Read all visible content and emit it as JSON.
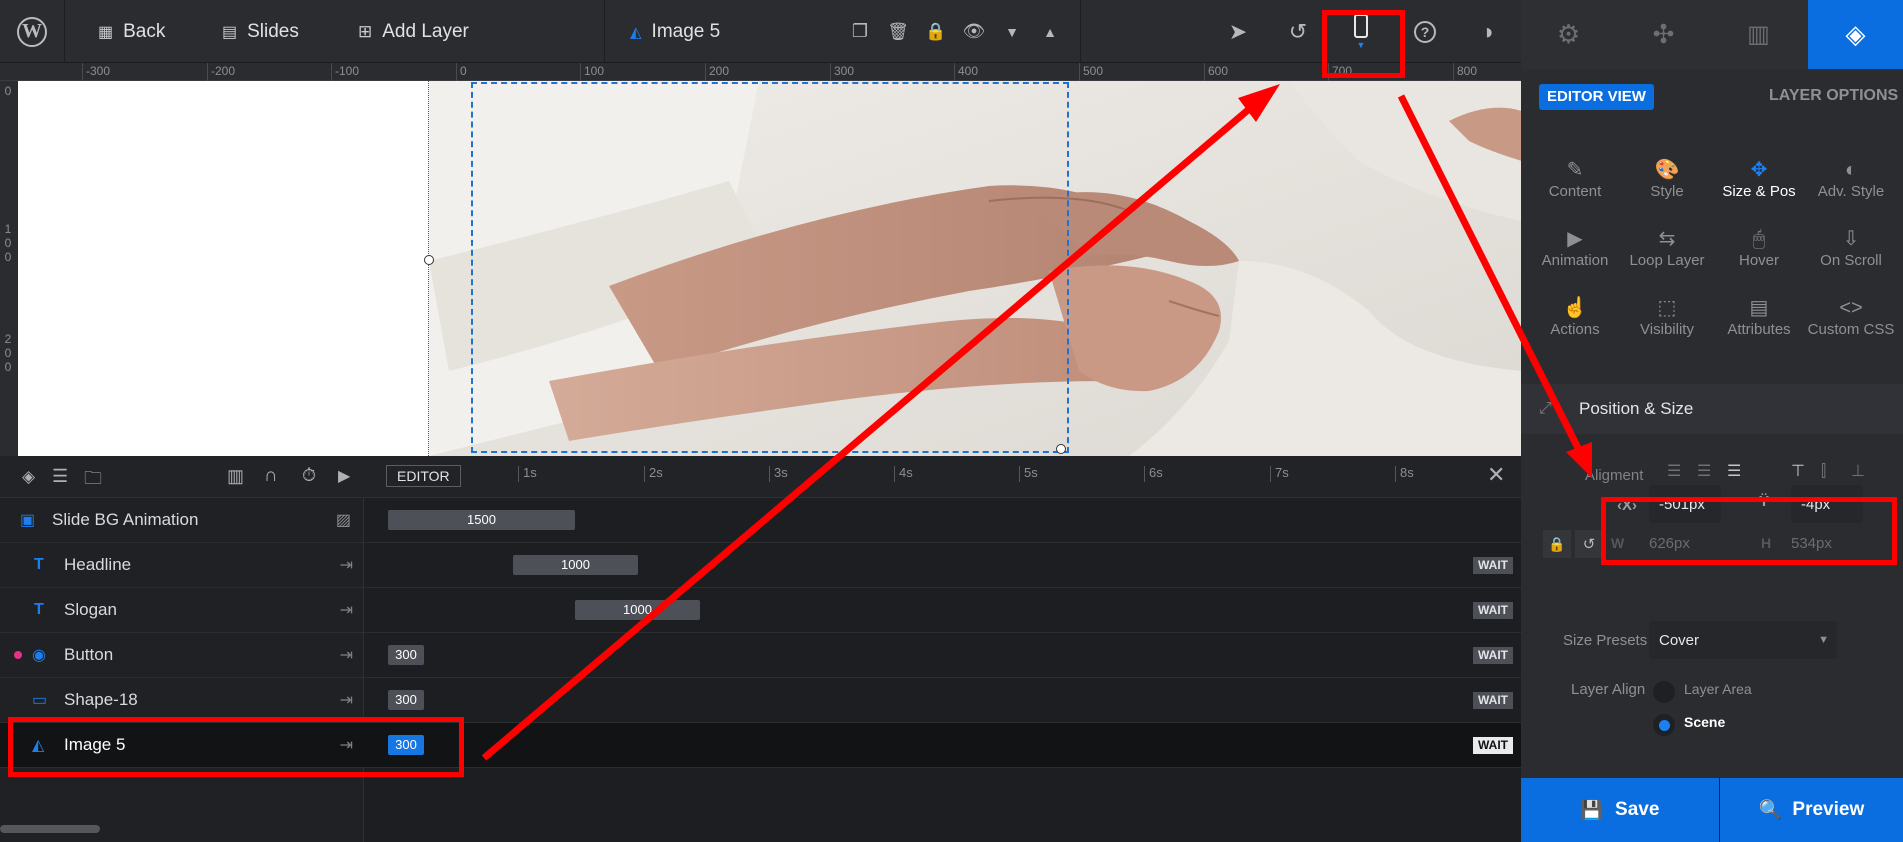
{
  "topbar": {
    "back": "Back",
    "slides": "Slides",
    "add_layer": "Add Layer",
    "layer_name": "Image 5"
  },
  "ruler": {
    "h": [
      "-300",
      "-200",
      "-100",
      "0",
      "100",
      "200",
      "300",
      "400",
      "500",
      "600",
      "700",
      "800"
    ],
    "v": [
      [
        "0"
      ],
      [
        "1",
        "0",
        "0"
      ],
      [
        "2",
        "0",
        "0"
      ]
    ]
  },
  "panel": {
    "editor_view": "EDITOR VIEW",
    "layer_options": "LAYER OPTIONS",
    "options": [
      {
        "label": "Content",
        "icon": "pencil-icon",
        "glyph": "✎"
      },
      {
        "label": "Style",
        "icon": "palette-icon",
        "glyph": "🎨"
      },
      {
        "label": "Size & Pos",
        "icon": "move-icon",
        "glyph": "✥"
      },
      {
        "label": "Adv. Style",
        "icon": "contrast-icon",
        "glyph": "◐"
      },
      {
        "label": "Animation",
        "icon": "play-icon",
        "glyph": "▶"
      },
      {
        "label": "Loop Layer",
        "icon": "loop-icon",
        "glyph": "⇆"
      },
      {
        "label": "Hover",
        "icon": "mouse-icon",
        "glyph": "🖱"
      },
      {
        "label": "On Scroll",
        "icon": "scroll-icon",
        "glyph": "⇩"
      },
      {
        "label": "Actions",
        "icon": "hand-icon",
        "glyph": "☝"
      },
      {
        "label": "Visibility",
        "icon": "visibility-icon",
        "glyph": "⬚"
      },
      {
        "label": "Attributes",
        "icon": "file-icon",
        "glyph": "▤"
      },
      {
        "label": "Custom CSS",
        "icon": "code-icon",
        "glyph": "<>"
      }
    ],
    "section_title": "Position & Size",
    "alignment_label": "Aligment",
    "x_value": "-501px",
    "y_value": "-4px",
    "w_label": "W",
    "w_value": "626px",
    "h_label": "H",
    "h_value": "534px",
    "size_presets_label": "Size Presets",
    "size_presets_value": "Cover",
    "layer_align_label": "Layer Align",
    "layer_align_options": [
      "Layer Area",
      "Scene"
    ],
    "layer_align_selected": "Scene"
  },
  "buttons": {
    "save": "Save",
    "preview": "Preview"
  },
  "timeline": {
    "editor_tag": "EDITOR",
    "ticks": [
      "1s",
      "2s",
      "3s",
      "4s",
      "5s",
      "6s",
      "7s",
      "8s"
    ],
    "wait": "WAIT",
    "layers": [
      {
        "name": "Slide BG Animation",
        "icon": "image-icon",
        "duration": "1500"
      },
      {
        "name": "Headline",
        "icon": "text-icon",
        "duration": "1000"
      },
      {
        "name": "Slogan",
        "icon": "text-icon",
        "duration": "1000"
      },
      {
        "name": "Button",
        "icon": "button-icon",
        "duration": "300"
      },
      {
        "name": "Shape-18",
        "icon": "shape-icon",
        "duration": "300"
      },
      {
        "name": "Image 5",
        "icon": "image-layer-icon",
        "duration": "300"
      }
    ]
  },
  "colors": {
    "accent": "#0a6ee0",
    "annotation": "#ff0000"
  }
}
